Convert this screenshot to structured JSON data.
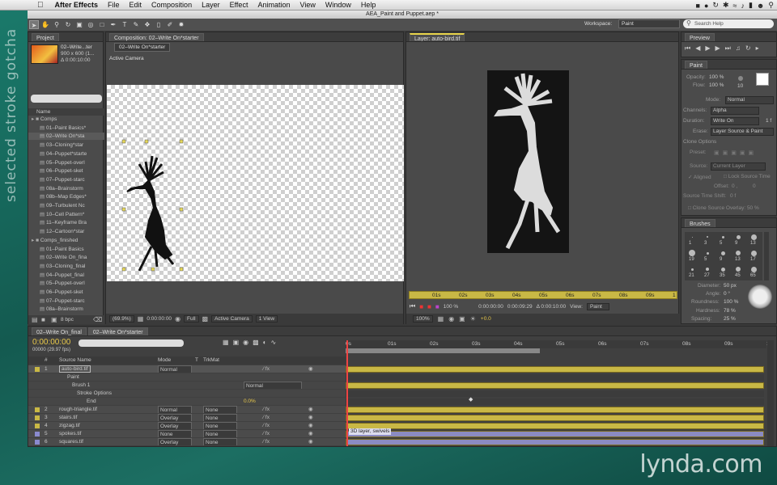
{
  "menubar": {
    "apple": "",
    "app": "After Effects",
    "items": [
      "File",
      "Edit",
      "Composition",
      "Layer",
      "Effect",
      "Animation",
      "View",
      "Window",
      "Help"
    ]
  },
  "window": {
    "title": "AEA_Paint and Puppet.aep *"
  },
  "workspace": {
    "label": "Workspace:",
    "value": "Paint",
    "search": "Search Help"
  },
  "project": {
    "tab": "Project",
    "comp_name": "02–Write...ter",
    "comp_size": "900 x 600 (1...",
    "comp_dur": "Δ 0:00:10:00",
    "column": "Name",
    "items": [
      "Comps",
      "01–Paint Basics*",
      "02–Write On*sta",
      "03–Cloning*star",
      "04–Puppet*starte",
      "05–Puppet-overl",
      "06–Puppet-sket",
      "07–Puppet-starc",
      "08a–Brainstorm",
      "08b–Map Edges*",
      "09–Turbulent Nc",
      "10–Cell Pattern*",
      "11–Keyframe Bra",
      "12–Cartoon*star",
      "Comps_finished",
      "01–Paint Basics",
      "02–Write On_fina",
      "03–Cloning_final",
      "04–Puppet_final",
      "05–Puppet-overl",
      "06–Puppet-sket",
      "07–Puppet-starc",
      "08a–Brainstorm"
    ],
    "bpc": "8 bpc"
  },
  "comp_viewer": {
    "tab": "Composition: 02–Write On*starter",
    "sub_tab": "02–Write On*starter",
    "camera": "Active Camera",
    "zoom": "(69.9%)",
    "time": "0:00:00:00",
    "res": "Full",
    "view_camera": "Active Camera",
    "views": "1 View"
  },
  "layer_viewer": {
    "tab": "Layer: auto-bird.tif",
    "ruler": [
      "01s",
      "02s",
      "03s",
      "04s",
      "05s",
      "06s",
      "07s",
      "08s",
      "09s",
      "1"
    ],
    "time_in": "0:00:00:00",
    "time_out": "0:00:09:29",
    "duration": "Δ 0:00:10:00",
    "view_label": "View:",
    "view": "Paint",
    "zoom": "100%",
    "exposure": "+0.0",
    "opacity": "100 %"
  },
  "preview": {
    "tab": "Preview"
  },
  "paint": {
    "tab": "Paint",
    "opacity_label": "Opacity:",
    "opacity": "100 %",
    "flow_label": "Flow:",
    "flow": "100 %",
    "size": "10",
    "mode_label": "Mode:",
    "mode": "Normal",
    "channels_label": "Channels:",
    "channels": "Alpha",
    "duration_label": "Duration:",
    "duration": "Write On",
    "duration_frames": "1 f",
    "erase_label": "Erase:",
    "erase": "Layer Source & Paint",
    "clone_title": "Clone Options",
    "preset_label": "Preset:",
    "source_label": "Source:",
    "source": "Current Layer",
    "aligned": "Aligned",
    "lock": "Lock Source Time",
    "offset_label": "Offset:",
    "offset_x": "0 ,",
    "offset_y": "0",
    "sts_label": "Source Time Shift:",
    "sts": "0 f",
    "overlay": "Clone Source Overlay:",
    "overlay_val": "50 %"
  },
  "brushes": {
    "tab": "Brushes",
    "sizes": [
      "1",
      "3",
      "5",
      "9",
      "13",
      "19",
      "5",
      "9",
      "13",
      "17",
      "21",
      "27",
      "35",
      "45",
      "65"
    ],
    "diameter_label": "Diameter:",
    "diameter": "50 px",
    "angle_label": "Angle:",
    "angle": "0 °",
    "round_label": "Roundness:",
    "round": "100 %",
    "hard_label": "Hardness:",
    "hard": "78 %",
    "spacing_label": "Spacing:",
    "spacing": "25 %"
  },
  "timeline": {
    "tabs": [
      "02–Write On_final",
      "02–Write On*starter"
    ],
    "timecode": "0:00:00:00",
    "fps": "00000 (29.97 fps)",
    "cols": {
      "num": "#",
      "source": "Source Name",
      "mode": "Mode",
      "t": "T",
      "trkmat": "TrkMat"
    },
    "ruler": [
      "0s",
      "01s",
      "02s",
      "03s",
      "04s",
      "05s",
      "06s",
      "07s",
      "08s",
      "09s",
      "10"
    ],
    "layers": [
      {
        "num": "1",
        "name": "auto-bird.tif",
        "mode": "Normal",
        "trk": ""
      },
      {
        "num": "",
        "name": "Paint",
        "mode": "",
        "trk": ""
      },
      {
        "num": "",
        "name": "Brush 1",
        "mode": "Normal",
        "trk": ""
      },
      {
        "num": "",
        "name": "Stroke Options",
        "mode": "",
        "trk": ""
      },
      {
        "num": "",
        "name": "End",
        "mode": "0.0%",
        "trk": ""
      },
      {
        "num": "2",
        "name": "rough-triangle.tif",
        "mode": "Normal",
        "trk": "None"
      },
      {
        "num": "3",
        "name": "stairs.tif",
        "mode": "Overlay",
        "trk": "None"
      },
      {
        "num": "4",
        "name": "zigzag.tif",
        "mode": "Overlay",
        "trk": "None"
      },
      {
        "num": "5",
        "name": "spokes.tif",
        "mode": "None",
        "trk": "None"
      },
      {
        "num": "6",
        "name": "squares.tif",
        "mode": "Overlay",
        "trk": "None"
      }
    ],
    "note": "3D layer, swivels"
  },
  "watermark": "selected stroke gotcha",
  "logo": "lynda.com"
}
